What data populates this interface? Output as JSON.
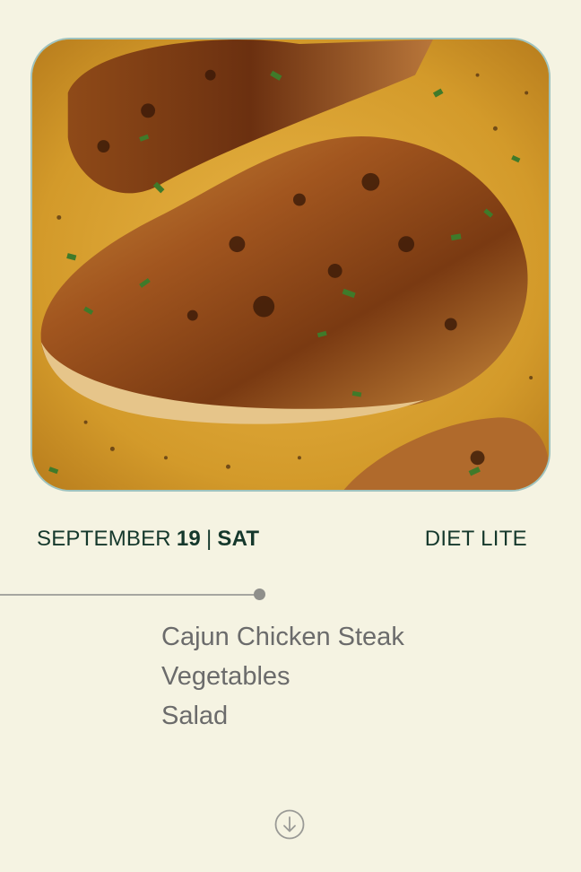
{
  "hero": {
    "image_subject": "seared cajun chicken breast in cream sauce"
  },
  "date": {
    "month": "SEPTEMBER",
    "day": "19",
    "separator": "|",
    "weekday": "SAT"
  },
  "plan": {
    "name": "DIET LITE"
  },
  "menu": {
    "items": [
      "Cajun Chicken Steak",
      "Vegetables",
      "Salad"
    ]
  },
  "colors": {
    "background": "#f5f3e2",
    "text_dark": "#15382c",
    "text_muted": "#6b6b6b",
    "frame_border": "#9fc3bf",
    "timeline": "#a6a6a0"
  },
  "icons": {
    "scroll": "arrow-down-circle-icon"
  }
}
